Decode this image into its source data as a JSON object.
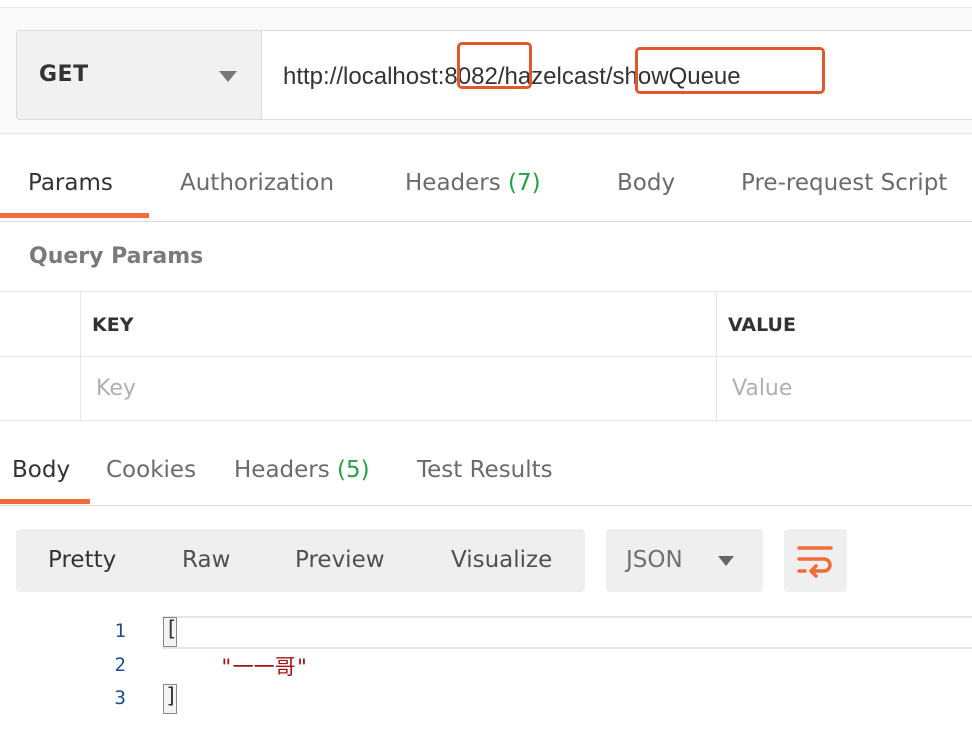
{
  "request": {
    "method": "GET",
    "url": "http://localhost:8082/hazelcast/showQueue",
    "highlight_color": "#e2572c"
  },
  "request_tabs": [
    {
      "label": "Params",
      "active": true
    },
    {
      "label": "Authorization"
    },
    {
      "label": "Headers",
      "count": "(7)"
    },
    {
      "label": "Body"
    },
    {
      "label": "Pre-request Script"
    }
  ],
  "query_params": {
    "title": "Query Params",
    "columns": [
      "KEY",
      "VALUE"
    ],
    "placeholders": [
      "Key",
      "Value"
    ]
  },
  "response_tabs": [
    {
      "label": "Body",
      "active": true
    },
    {
      "label": "Cookies"
    },
    {
      "label": "Headers",
      "count": "(5)"
    },
    {
      "label": "Test Results"
    }
  ],
  "response_toolbar": {
    "formats": [
      "Pretty",
      "Raw",
      "Preview",
      "Visualize"
    ],
    "selected_format": "Pretty",
    "language": "JSON",
    "wrap_icon": "wrap-lines-icon"
  },
  "response_body": {
    "line_numbers": [
      "1",
      "2",
      "3"
    ],
    "lines": [
      "[",
      "\"一一哥\"",
      "]"
    ]
  },
  "colors": {
    "accent": "#f26b3a",
    "count_green": "#27a046"
  }
}
